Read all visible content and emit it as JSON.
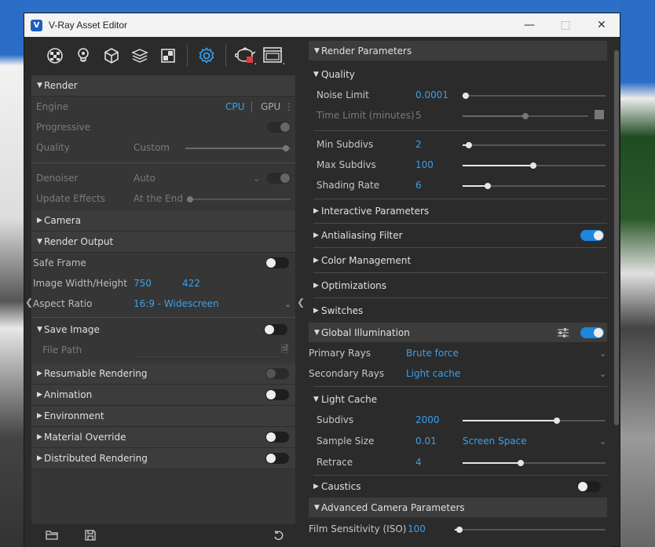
{
  "window": {
    "title": "V-Ray Asset Editor"
  },
  "toolbar": {
    "icons": [
      "materials-icon",
      "lights-icon",
      "geometry-icon",
      "render-elements-icon",
      "textures-icon",
      "settings-icon",
      "render-teapot-icon",
      "frame-buffer-icon"
    ]
  },
  "render": {
    "header": "Render",
    "engine_label": "Engine",
    "engine_cpu": "CPU",
    "engine_gpu": "GPU",
    "progressive_label": "Progressive",
    "quality_label": "Quality",
    "quality_value": "Custom",
    "denoiser_label": "Denoiser",
    "denoiser_value": "Auto",
    "update_effects_label": "Update Effects",
    "update_effects_value": "At the End"
  },
  "camera": {
    "header": "Camera"
  },
  "render_output": {
    "header": "Render Output",
    "safe_frame_label": "Safe Frame",
    "image_wh_label": "Image Width/Height",
    "width": "750",
    "height": "422",
    "aspect_label": "Aspect Ratio",
    "aspect_value": "16:9 - Widescreen"
  },
  "save_image": {
    "header": "Save Image",
    "file_path_label": "File Path"
  },
  "left_sections": {
    "resumable": "Resumable Rendering",
    "animation": "Animation",
    "environment": "Environment",
    "material_override": "Material Override",
    "distributed": "Distributed Rendering"
  },
  "render_parameters": {
    "header": "Render Parameters",
    "quality": {
      "header": "Quality",
      "noise_limit_label": "Noise Limit",
      "noise_limit": "0.0001",
      "time_limit_label": "Time Limit (minutes)",
      "time_limit": "5",
      "min_subdivs_label": "Min Subdivs",
      "min_subdivs": "2",
      "max_subdivs_label": "Max Subdivs",
      "max_subdivs": "100",
      "shading_rate_label": "Shading Rate",
      "shading_rate": "6"
    },
    "interactive": "Interactive Parameters",
    "antialiasing": "Antialiasing Filter",
    "color_management": "Color Management",
    "optimizations": "Optimizations",
    "switches": "Switches",
    "gi": {
      "header": "Global Illumination",
      "primary_label": "Primary Rays",
      "primary_value": "Brute force",
      "secondary_label": "Secondary Rays",
      "secondary_value": "Light cache"
    },
    "light_cache": {
      "header": "Light Cache",
      "subdivs_label": "Subdivs",
      "subdivs": "2000",
      "sample_size_label": "Sample Size",
      "sample_size": "0.01",
      "sample_space": "Screen Space",
      "retrace_label": "Retrace",
      "retrace": "4"
    },
    "caustics": "Caustics",
    "advanced_camera": "Advanced Camera Parameters",
    "film_label": "Film Sensitivity (ISO)",
    "film_value": "100"
  },
  "colors": {
    "accent": "#3ba0ea",
    "toggle_on": "#1f86dd",
    "panel": "#363636",
    "bg": "#2b2b2b"
  }
}
